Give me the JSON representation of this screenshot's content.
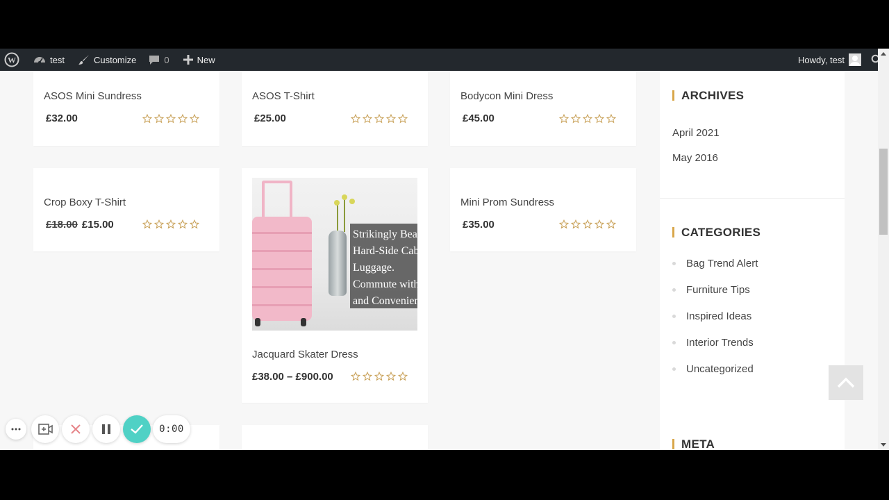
{
  "adminbar": {
    "site_name": "test",
    "customize_label": "Customize",
    "comments_count": "0",
    "new_label": "New",
    "howdy_label": "Howdy, test"
  },
  "products": [
    {
      "name": "ASOS Mini Sundress",
      "price": "£32.00"
    },
    {
      "name": "ASOS T-Shirt",
      "price": "£25.00"
    },
    {
      "name": "Bodycon Mini Dress",
      "price": "£45.00"
    },
    {
      "name": "Crop Boxy T-Shirt",
      "price_old": "£18.00",
      "price": "£15.00"
    },
    {
      "name": "Jacquard Skater Dress",
      "price_range": "£38.00 – £900.00",
      "image_text": [
        "Strikingly Beau",
        "Hard-Side Cabi",
        "Luggage.",
        "Commute with",
        "and Convenien"
      ]
    },
    {
      "name": "Mini Prom Sundress",
      "price": "£35.00"
    }
  ],
  "sidebar": {
    "archives": {
      "title": "ARCHIVES",
      "items": [
        "April 2021",
        "May 2016"
      ]
    },
    "categories": {
      "title": "CATEGORIES",
      "items": [
        "Bag Trend Alert",
        "Furniture Tips",
        "Inspired Ideas",
        "Interior Trends",
        "Uncategorized"
      ]
    },
    "meta": {
      "title": "META"
    }
  },
  "recorder": {
    "timer": "0:00"
  },
  "colors": {
    "accent": "#d9a74a",
    "check": "#4fd1c5",
    "star": "#c9a25a",
    "adminbar": "#23282d"
  }
}
